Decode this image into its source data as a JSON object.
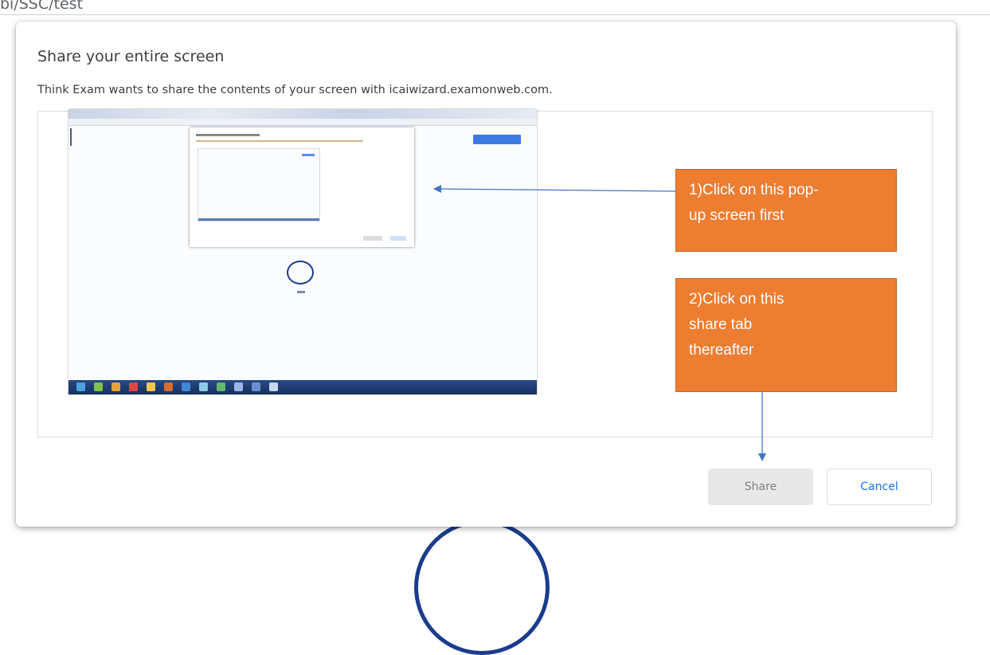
{
  "browser": {
    "url_fragment": "bi/SSC/test"
  },
  "dialog": {
    "title": "Share your entire screen",
    "subtitle": "Think Exam wants to share the contents of your screen with icaiwizard.examonweb.com.",
    "share_label": "Share",
    "cancel_label": "Cancel"
  },
  "annotations": {
    "callout1_line1": "1)Click on this pop-",
    "callout1_line2": "up screen first",
    "callout2_line1": "2)Click on this",
    "callout2_line2": "share tab",
    "callout2_line3": "thereafter"
  },
  "colors": {
    "callout": "#ed7d31",
    "arrow": "#4472c4",
    "cancel_text": "#1a73e8"
  }
}
